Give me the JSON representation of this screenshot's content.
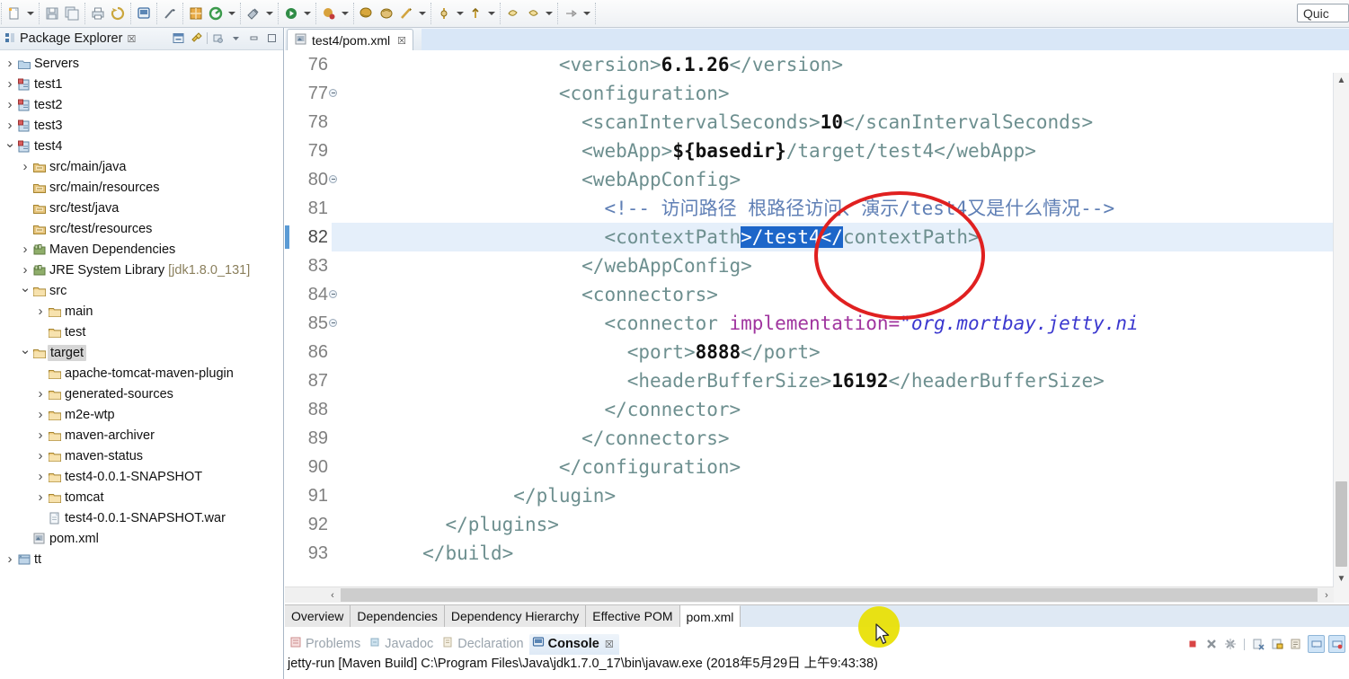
{
  "window": {
    "quick_access": "Quic"
  },
  "toolbar": {
    "groups": [
      {
        "items": [
          {
            "icon": "new-file-icon",
            "arrow": true
          }
        ]
      },
      {
        "items": [
          {
            "icon": "save-icon",
            "arrow": false
          },
          {
            "icon": "save-all-icon",
            "arrow": false
          }
        ]
      },
      {
        "items": [
          {
            "icon": "print-icon",
            "arrow": false
          },
          {
            "icon": "refresh-icon",
            "arrow": false
          }
        ]
      },
      {
        "items": [
          {
            "icon": "terminal-icon",
            "arrow": false
          }
        ]
      },
      {
        "items": [
          {
            "icon": "link-editor-icon",
            "arrow": false
          }
        ]
      },
      {
        "items": [
          {
            "icon": "new-java-package-icon",
            "arrow": false
          },
          {
            "icon": "external-tools-icon",
            "arrow": true
          }
        ]
      },
      {
        "items": [
          {
            "icon": "search-icon",
            "arrow": true
          }
        ]
      },
      {
        "items": [
          {
            "icon": "run-icon",
            "arrow": true
          }
        ]
      },
      {
        "items": [
          {
            "icon": "debug-icon",
            "arrow": true
          }
        ]
      },
      {
        "items": [
          {
            "icon": "coverage-icon",
            "arrow": false
          },
          {
            "icon": "profile-icon",
            "arrow": false
          },
          {
            "icon": "run-last-icon",
            "arrow": true
          }
        ]
      },
      {
        "items": [
          {
            "icon": "git-commit-icon",
            "arrow": true
          },
          {
            "icon": "git-push-icon",
            "arrow": true
          }
        ]
      },
      {
        "items": [
          {
            "icon": "prev-annotation-icon",
            "arrow": false
          },
          {
            "icon": "next-annotation-icon",
            "arrow": true
          }
        ]
      },
      {
        "items": [
          {
            "icon": "back-nav-icon",
            "arrow": true
          }
        ]
      }
    ]
  },
  "package_explorer": {
    "title": "Package Explorer",
    "close_glyph": "☒",
    "toolbar_icons": [
      "collapse-all-icon",
      "link-with-editor-icon",
      "view-menu-icon",
      "minimize-icon",
      "maximize-icon"
    ],
    "tree": [
      {
        "label": "Servers",
        "indent": 0,
        "arrow": "closed",
        "icon": "folder-server-icon"
      },
      {
        "label": "test1",
        "indent": 0,
        "arrow": "closed",
        "icon": "java-project-icon"
      },
      {
        "label": "test2",
        "indent": 0,
        "arrow": "closed",
        "icon": "java-project-icon"
      },
      {
        "label": "test3",
        "indent": 0,
        "arrow": "closed",
        "icon": "java-project-icon"
      },
      {
        "label": "test4",
        "indent": 0,
        "arrow": "open",
        "icon": "java-project-icon"
      },
      {
        "label": "src/main/java",
        "indent": 1,
        "arrow": "closed",
        "icon": "source-folder-icon"
      },
      {
        "label": "src/main/resources",
        "indent": 1,
        "arrow": "none",
        "icon": "source-folder-icon"
      },
      {
        "label": "src/test/java",
        "indent": 1,
        "arrow": "none",
        "icon": "source-folder-icon"
      },
      {
        "label": "src/test/resources",
        "indent": 1,
        "arrow": "none",
        "icon": "source-folder-icon"
      },
      {
        "label": "Maven Dependencies",
        "indent": 1,
        "arrow": "closed",
        "icon": "library-icon"
      },
      {
        "label": "JRE System Library",
        "sublabel": " [jdk1.8.0_131]",
        "indent": 1,
        "arrow": "closed",
        "icon": "library-icon"
      },
      {
        "label": "src",
        "indent": 1,
        "arrow": "open",
        "icon": "folder-icon"
      },
      {
        "label": "main",
        "indent": 2,
        "arrow": "closed",
        "icon": "folder-icon"
      },
      {
        "label": "test",
        "indent": 2,
        "arrow": "none",
        "icon": "folder-icon"
      },
      {
        "label": "target",
        "indent": 1,
        "arrow": "open",
        "icon": "folder-icon",
        "selected": true
      },
      {
        "label": "apache-tomcat-maven-plugin",
        "indent": 2,
        "arrow": "none",
        "icon": "folder-icon"
      },
      {
        "label": "generated-sources",
        "indent": 2,
        "arrow": "closed",
        "icon": "folder-icon"
      },
      {
        "label": "m2e-wtp",
        "indent": 2,
        "arrow": "closed",
        "icon": "folder-icon"
      },
      {
        "label": "maven-archiver",
        "indent": 2,
        "arrow": "closed",
        "icon": "folder-icon"
      },
      {
        "label": "maven-status",
        "indent": 2,
        "arrow": "closed",
        "icon": "folder-icon"
      },
      {
        "label": "test4-0.0.1-SNAPSHOT",
        "indent": 2,
        "arrow": "closed",
        "icon": "folder-icon"
      },
      {
        "label": "tomcat",
        "indent": 2,
        "arrow": "closed",
        "icon": "folder-icon"
      },
      {
        "label": "test4-0.0.1-SNAPSHOT.war",
        "indent": 2,
        "arrow": "none",
        "icon": "file-icon"
      },
      {
        "label": "pom.xml",
        "indent": 1,
        "arrow": "none",
        "icon": "maven-pom-icon"
      },
      {
        "label": "tt",
        "indent": 0,
        "arrow": "closed",
        "icon": "web-project-icon"
      }
    ]
  },
  "editor": {
    "tab": {
      "label": "test4/pom.xml",
      "close_glyph": "☒",
      "icon": "maven-pom-icon"
    },
    "current_line": 82,
    "lines": [
      {
        "num": "76",
        "fold": false,
        "tokens": [
          {
            "t": "                    ",
            "c": "plain"
          },
          {
            "t": "<version>",
            "c": "tag"
          },
          {
            "t": "6.1.26",
            "c": "txt"
          },
          {
            "t": "</version>",
            "c": "tag"
          }
        ]
      },
      {
        "num": "77",
        "fold": true,
        "tokens": [
          {
            "t": "                    ",
            "c": "plain"
          },
          {
            "t": "<configuration>",
            "c": "tag"
          }
        ]
      },
      {
        "num": "78",
        "fold": false,
        "tokens": [
          {
            "t": "                      ",
            "c": "plain"
          },
          {
            "t": "<scanIntervalSeconds>",
            "c": "tag"
          },
          {
            "t": "10",
            "c": "txt"
          },
          {
            "t": "</scanIntervalSeconds>",
            "c": "tag"
          }
        ]
      },
      {
        "num": "79",
        "fold": false,
        "tokens": [
          {
            "t": "                      ",
            "c": "plain"
          },
          {
            "t": "<webApp>",
            "c": "tag"
          },
          {
            "t": "${basedir}",
            "c": "txt"
          },
          {
            "t": "/target/test4",
            "c": "tag"
          },
          {
            "t": "</webApp>",
            "c": "tag"
          }
        ]
      },
      {
        "num": "80",
        "fold": true,
        "tokens": [
          {
            "t": "                      ",
            "c": "plain"
          },
          {
            "t": "<webAppConfig>",
            "c": "tag"
          }
        ]
      },
      {
        "num": "81",
        "fold": false,
        "tokens": [
          {
            "t": "                        ",
            "c": "plain"
          },
          {
            "t": "<!-- 访问路径 根路径访问、演示/test4又是什么情况-->",
            "c": "cmt"
          }
        ]
      },
      {
        "num": "82",
        "fold": false,
        "current": true,
        "tokens": [
          {
            "t": "                        ",
            "c": "plain"
          },
          {
            "t": "<contextPath",
            "c": "tag"
          },
          {
            "t": ">/test4</",
            "c": "sel"
          },
          {
            "t": "contextPath>",
            "c": "tag"
          }
        ]
      },
      {
        "num": "83",
        "fold": false,
        "tokens": [
          {
            "t": "                      ",
            "c": "plain"
          },
          {
            "t": "</webAppConfig>",
            "c": "tag"
          }
        ]
      },
      {
        "num": "84",
        "fold": true,
        "tokens": [
          {
            "t": "                      ",
            "c": "plain"
          },
          {
            "t": "<connectors>",
            "c": "tag"
          }
        ]
      },
      {
        "num": "85",
        "fold": true,
        "tokens": [
          {
            "t": "                        ",
            "c": "plain"
          },
          {
            "t": "<connector ",
            "c": "tag"
          },
          {
            "t": "implementation=",
            "c": "attr"
          },
          {
            "t": "\"org.mortbay.jetty.ni",
            "c": "val"
          }
        ]
      },
      {
        "num": "86",
        "fold": false,
        "tokens": [
          {
            "t": "                          ",
            "c": "plain"
          },
          {
            "t": "<port>",
            "c": "tag"
          },
          {
            "t": "8888",
            "c": "txt"
          },
          {
            "t": "</port>",
            "c": "tag"
          }
        ]
      },
      {
        "num": "87",
        "fold": false,
        "tokens": [
          {
            "t": "                          ",
            "c": "plain"
          },
          {
            "t": "<headerBufferSize>",
            "c": "tag"
          },
          {
            "t": "16192",
            "c": "txt"
          },
          {
            "t": "</headerBufferSize>",
            "c": "tag"
          }
        ]
      },
      {
        "num": "88",
        "fold": false,
        "tokens": [
          {
            "t": "                        ",
            "c": "plain"
          },
          {
            "t": "</connector>",
            "c": "tag"
          }
        ]
      },
      {
        "num": "89",
        "fold": false,
        "tokens": [
          {
            "t": "                      ",
            "c": "plain"
          },
          {
            "t": "</connectors>",
            "c": "tag"
          }
        ]
      },
      {
        "num": "90",
        "fold": false,
        "tokens": [
          {
            "t": "                    ",
            "c": "plain"
          },
          {
            "t": "</configuration>",
            "c": "tag"
          }
        ]
      },
      {
        "num": "91",
        "fold": false,
        "tokens": [
          {
            "t": "                ",
            "c": "plain"
          },
          {
            "t": "</plugin>",
            "c": "tag"
          }
        ]
      },
      {
        "num": "92",
        "fold": false,
        "tokens": [
          {
            "t": "          ",
            "c": "plain"
          },
          {
            "t": "</plugins>",
            "c": "tag"
          }
        ]
      },
      {
        "num": "93",
        "fold": false,
        "tokens": [
          {
            "t": "        ",
            "c": "plain"
          },
          {
            "t": "</build>",
            "c": "tag"
          }
        ]
      }
    ]
  },
  "form_tabs": {
    "items": [
      {
        "label": "Overview",
        "active": false
      },
      {
        "label": "Dependencies",
        "active": false
      },
      {
        "label": "Dependency Hierarchy",
        "active": false
      },
      {
        "label": "Effective POM",
        "active": false
      },
      {
        "label": "pom.xml",
        "active": true
      }
    ]
  },
  "bottom_view": {
    "tabs": [
      {
        "label": "Problems",
        "icon": "problems-icon",
        "active": false
      },
      {
        "label": "Javadoc",
        "icon": "javadoc-icon",
        "active": false
      },
      {
        "label": "Declaration",
        "icon": "declaration-icon",
        "active": false
      },
      {
        "label": "Console",
        "icon": "console-icon",
        "active": true,
        "close_glyph": "☒"
      }
    ],
    "toolbar_icons": [
      "terminate-icon",
      "remove-launch-icon",
      "remove-all-launches-icon",
      "clear-console-icon",
      "scroll-lock-icon",
      "word-wrap-icon",
      "pin-console-icon",
      "display-selected-console-icon",
      "open-console-icon"
    ],
    "console_text": "jetty-run [Maven Build] C:\\Program Files\\Java\\jdk1.7.0_17\\bin\\javaw.exe (2018年5月29日 上午9:43:38)"
  },
  "annotations": {
    "red_ellipse": "#e02020",
    "click_highlight": "#e8e000"
  }
}
